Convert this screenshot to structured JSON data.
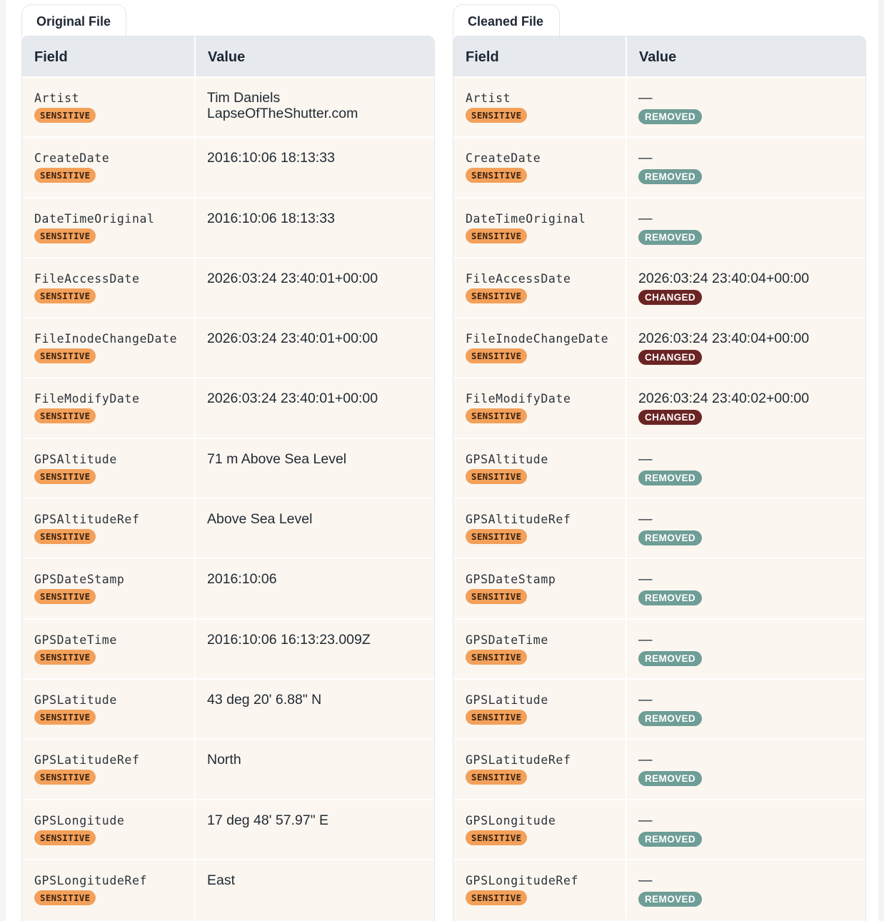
{
  "original": {
    "tab_label": "Original File",
    "headers": {
      "field": "Field",
      "value": "Value"
    },
    "rows": [
      {
        "field": "Artist",
        "badge": "SENSITIVE",
        "value": "Tim Daniels\nLapseOfTheShutter.com"
      },
      {
        "field": "CreateDate",
        "badge": "SENSITIVE",
        "value": "2016:10:06 18:13:33"
      },
      {
        "field": "DateTimeOriginal",
        "badge": "SENSITIVE",
        "value": "2016:10:06 18:13:33"
      },
      {
        "field": "FileAccessDate",
        "badge": "SENSITIVE",
        "value": "2026:03:24 23:40:01+00:00"
      },
      {
        "field": "FileInodeChangeDate",
        "badge": "SENSITIVE",
        "value": "2026:03:24 23:40:01+00:00"
      },
      {
        "field": "FileModifyDate",
        "badge": "SENSITIVE",
        "value": "2026:03:24 23:40:01+00:00"
      },
      {
        "field": "GPSAltitude",
        "badge": "SENSITIVE",
        "value": "71 m Above Sea Level"
      },
      {
        "field": "GPSAltitudeRef",
        "badge": "SENSITIVE",
        "value": "Above Sea Level"
      },
      {
        "field": "GPSDateStamp",
        "badge": "SENSITIVE",
        "value": "2016:10:06"
      },
      {
        "field": "GPSDateTime",
        "badge": "SENSITIVE",
        "value": "2016:10:06 16:13:23.009Z"
      },
      {
        "field": "GPSLatitude",
        "badge": "SENSITIVE",
        "value": "43 deg 20' 6.88\" N"
      },
      {
        "field": "GPSLatitudeRef",
        "badge": "SENSITIVE",
        "value": "North"
      },
      {
        "field": "GPSLongitude",
        "badge": "SENSITIVE",
        "value": "17 deg 48' 57.97\" E"
      },
      {
        "field": "GPSLongitudeRef",
        "badge": "SENSITIVE",
        "value": "East"
      }
    ]
  },
  "cleaned": {
    "tab_label": "Cleaned File",
    "headers": {
      "field": "Field",
      "value": "Value"
    },
    "rows": [
      {
        "field": "Artist",
        "badge": "SENSITIVE",
        "value": "—",
        "status": "REMOVED"
      },
      {
        "field": "CreateDate",
        "badge": "SENSITIVE",
        "value": "—",
        "status": "REMOVED"
      },
      {
        "field": "DateTimeOriginal",
        "badge": "SENSITIVE",
        "value": "—",
        "status": "REMOVED"
      },
      {
        "field": "FileAccessDate",
        "badge": "SENSITIVE",
        "value": "2026:03:24 23:40:04+00:00",
        "status": "CHANGED"
      },
      {
        "field": "FileInodeChangeDate",
        "badge": "SENSITIVE",
        "value": "2026:03:24 23:40:04+00:00",
        "status": "CHANGED"
      },
      {
        "field": "FileModifyDate",
        "badge": "SENSITIVE",
        "value": "2026:03:24 23:40:02+00:00",
        "status": "CHANGED"
      },
      {
        "field": "GPSAltitude",
        "badge": "SENSITIVE",
        "value": "—",
        "status": "REMOVED"
      },
      {
        "field": "GPSAltitudeRef",
        "badge": "SENSITIVE",
        "value": "—",
        "status": "REMOVED"
      },
      {
        "field": "GPSDateStamp",
        "badge": "SENSITIVE",
        "value": "—",
        "status": "REMOVED"
      },
      {
        "field": "GPSDateTime",
        "badge": "SENSITIVE",
        "value": "—",
        "status": "REMOVED"
      },
      {
        "field": "GPSLatitude",
        "badge": "SENSITIVE",
        "value": "—",
        "status": "REMOVED"
      },
      {
        "field": "GPSLatitudeRef",
        "badge": "SENSITIVE",
        "value": "—",
        "status": "REMOVED"
      },
      {
        "field": "GPSLongitude",
        "badge": "SENSITIVE",
        "value": "—",
        "status": "REMOVED"
      },
      {
        "field": "GPSLongitudeRef",
        "badge": "SENSITIVE",
        "value": "—",
        "status": "REMOVED"
      }
    ]
  },
  "colors": {
    "sensitive_badge": "#f3a05a",
    "removed_badge": "#6e9e97",
    "changed_badge": "#6b2424",
    "row_background": "#fbf6ef",
    "header_background": "#e6eaee"
  }
}
